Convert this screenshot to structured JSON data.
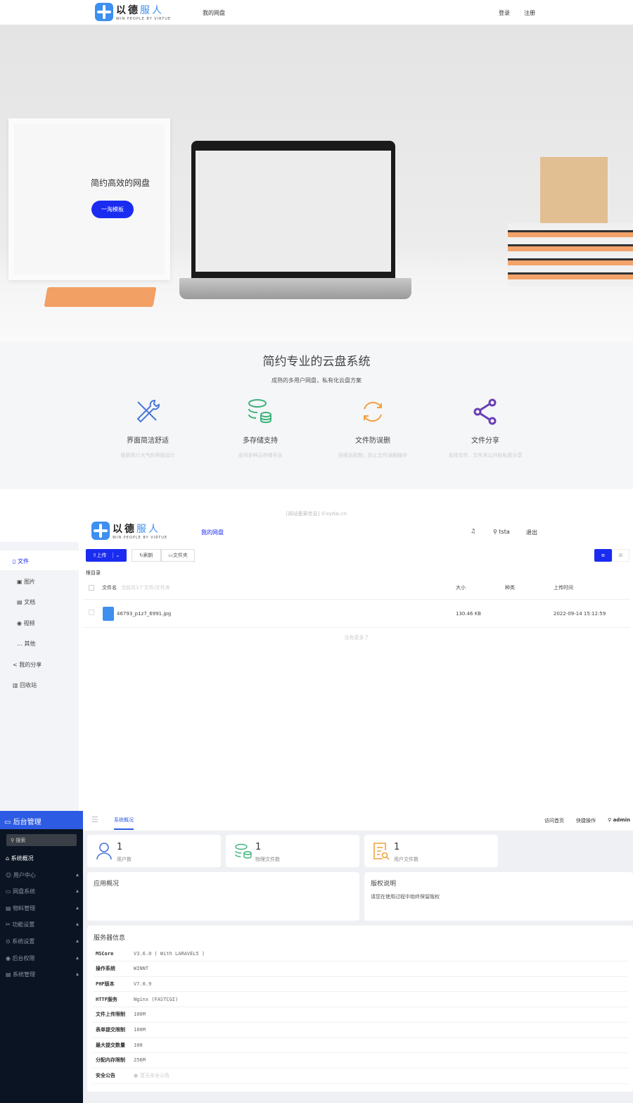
{
  "site": {
    "logo_cn": "以德",
    "logo_cn2": "服人",
    "logo_en": "WIN PEOPLE BY VIRTUE",
    "nav_mydisk": "我的网盘",
    "login": "登录",
    "register": "注册"
  },
  "hero": {
    "title": "简约高效的网盘",
    "button": "一淘模板"
  },
  "features": {
    "title": "简约专业的云盘系统",
    "subtitle": "成熟的多用户网盘，私有化云盘方案",
    "items": [
      {
        "icon": "tools-icon",
        "title": "界面简洁舒适",
        "desc": "极致简介大气的界面设计",
        "color": "#4a78d8"
      },
      {
        "icon": "storage-icon",
        "title": "多存储支持",
        "desc": "支持多种云存储平台",
        "color": "#3bb37a"
      },
      {
        "icon": "refresh-icon",
        "title": "文件防误删",
        "desc": "回收站机制，防止文件误删操作",
        "color": "#f0a040"
      },
      {
        "icon": "share-icon",
        "title": "文件分享",
        "desc": "支持文件、文件夹公开和私密分享",
        "color": "#6a3fb5"
      }
    ]
  },
  "footer": {
    "text": "[网站备案信息] ©xydai.cn"
  },
  "filemanager": {
    "header": {
      "nav": "我的网盘",
      "user": "tsta",
      "logout": "退出"
    },
    "sidebar": [
      {
        "label": "文件",
        "icon": "file-icon"
      },
      {
        "label": "图片",
        "icon": "image-icon"
      },
      {
        "label": "文档",
        "icon": "document-icon"
      },
      {
        "label": "视频",
        "icon": "video-icon"
      },
      {
        "label": "其他",
        "icon": "more-icon"
      },
      {
        "label": "我的分享",
        "icon": "share-icon"
      },
      {
        "label": "回收站",
        "icon": "trash-icon"
      }
    ],
    "toolbar": {
      "upload": "上传",
      "refresh": "刷新",
      "folder": "文件夹"
    },
    "breadcrumb": "根目录",
    "columns": {
      "name": "文件名",
      "count_hint": "当前共1个文件/文件夹",
      "size": "大小",
      "type": "种类",
      "time": "上传时间"
    },
    "files": [
      {
        "name": "46793_p1z7_6991.jpg",
        "size": "130.46 KB",
        "type": "",
        "time": "2022-09-14 15:12:59"
      }
    ],
    "no_more": "没有更多了",
    "accent": "#1a2cf0"
  },
  "admin": {
    "brand": "后台管理",
    "search": "搜索",
    "menu": [
      {
        "label": "系统概况",
        "active": true
      },
      {
        "label": "用户中心"
      },
      {
        "label": "网盘系统"
      },
      {
        "label": "物料管理"
      },
      {
        "label": "功能设置"
      },
      {
        "label": "系统设置"
      },
      {
        "label": "后台权限"
      },
      {
        "label": "系统管理"
      }
    ],
    "tab": "系统概况",
    "top_links": {
      "home": "访问首页",
      "quick": "快捷操作",
      "user": "admin"
    },
    "stats": [
      {
        "value": "1",
        "label": "用户数"
      },
      {
        "value": "1",
        "label": "物理文件数"
      },
      {
        "value": "1",
        "label": "用户文件数"
      }
    ],
    "app_overview": "应用概况",
    "copyright": {
      "title": "版权说明",
      "text": "请您在使用过程中始终保留版权"
    },
    "server": {
      "title": "服务器信息",
      "rows": [
        {
          "k": "MSCore",
          "v": "V3.6.0 ( With LARAVEL5 )"
        },
        {
          "k": "操作系统",
          "v": "WINNT"
        },
        {
          "k": "PHP版本",
          "v": "V7.0.9"
        },
        {
          "k": "HTTP服务",
          "v": "Nginx (FASTCGI)"
        },
        {
          "k": "文件上传限制",
          "v": "100M"
        },
        {
          "k": "表单提交限制",
          "v": "100M"
        },
        {
          "k": "最大提交数量",
          "v": "100"
        },
        {
          "k": "分配内存限制",
          "v": "256M"
        },
        {
          "k": "安全公告",
          "v": "暂无安全公告"
        }
      ]
    },
    "brand_color": "#2d5be3",
    "sidebar_color": "#0b1423"
  }
}
